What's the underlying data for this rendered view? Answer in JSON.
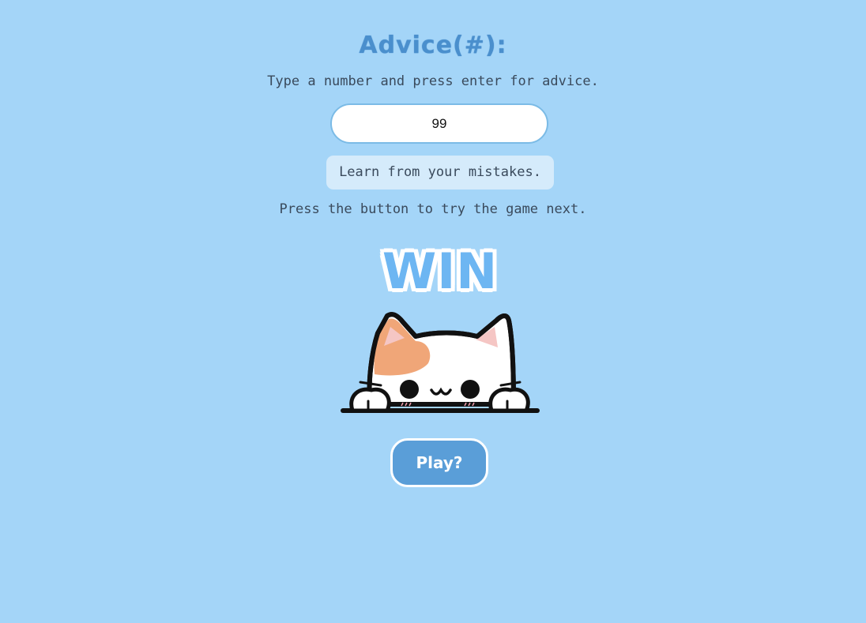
{
  "header": {
    "title": "Advice(#):"
  },
  "advice": {
    "instruction": "Type a number and press enter for advice.",
    "input_value": "99",
    "result": "Learn from your mistakes.",
    "next_prompt": "Press the button to try the game next."
  },
  "banner": {
    "text": "WIN"
  },
  "play": {
    "label": "Play?"
  },
  "colors": {
    "background": "#a4d5f8",
    "title": "#4a8fcd",
    "button": "#5a9ed8",
    "win_letters": "#6db6f2",
    "advice_box": "#d5ebfb"
  },
  "icons": {
    "mascot": "peeking-cat-icon"
  }
}
